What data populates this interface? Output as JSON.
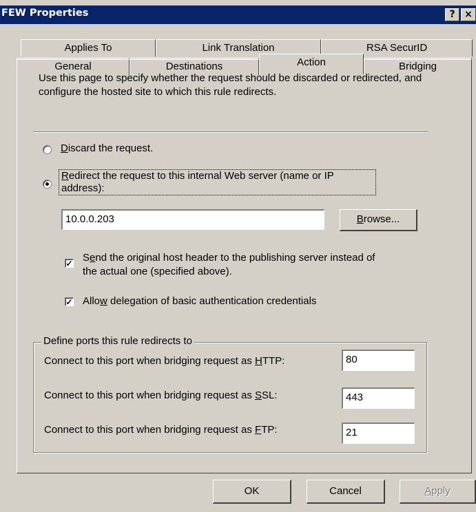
{
  "window": {
    "title": "FEW Properties",
    "help_button": "?",
    "close_button": "×"
  },
  "tabs": {
    "row1": [
      "Applies To",
      "Link Translation",
      "RSA SecurID"
    ],
    "row2": [
      "General",
      "Destinations",
      "Action",
      "Bridging"
    ],
    "active": "Action"
  },
  "description": "Use this page to specify whether the request should be discarded or redirected, and configure the hosted site to which this rule redirects.",
  "options": {
    "discard": {
      "label_pre": "",
      "label_key": "D",
      "label_post": "iscard the request.",
      "selected": false
    },
    "redirect": {
      "label_line1_key": "R",
      "label_line1": "edirect the request to this internal Web server (name or IP",
      "label_line2": "address):",
      "selected": true
    }
  },
  "server": {
    "value": "10.0.0.203",
    "browse_key": "B",
    "browse_rest": "rowse..."
  },
  "checkboxes": {
    "host_header": {
      "pre": "S",
      "key": "e",
      "line1_rest": "nd the original host header to the publishing server instead of",
      "line2": "the actual one (specified above).",
      "checked": true
    },
    "delegation": {
      "pre": "Allo",
      "key": "w",
      "post": " delegation of basic authentication credentials",
      "checked": true
    }
  },
  "ports": {
    "group_title": "Define ports this rule redirects to",
    "http": {
      "pre": "Connect to this port when bridging request as ",
      "key": "H",
      "post": "TTP:",
      "value": "80"
    },
    "ssl": {
      "pre": "Connect to this port when bridging request as ",
      "key": "S",
      "post": "SL:",
      "value": "443"
    },
    "ftp": {
      "pre": "Connect to this port when bridging request as ",
      "key": "F",
      "post": "TP:",
      "value": "21"
    }
  },
  "buttons": {
    "ok": "OK",
    "cancel": "Cancel",
    "apply_key": "A",
    "apply_rest": "pply"
  }
}
